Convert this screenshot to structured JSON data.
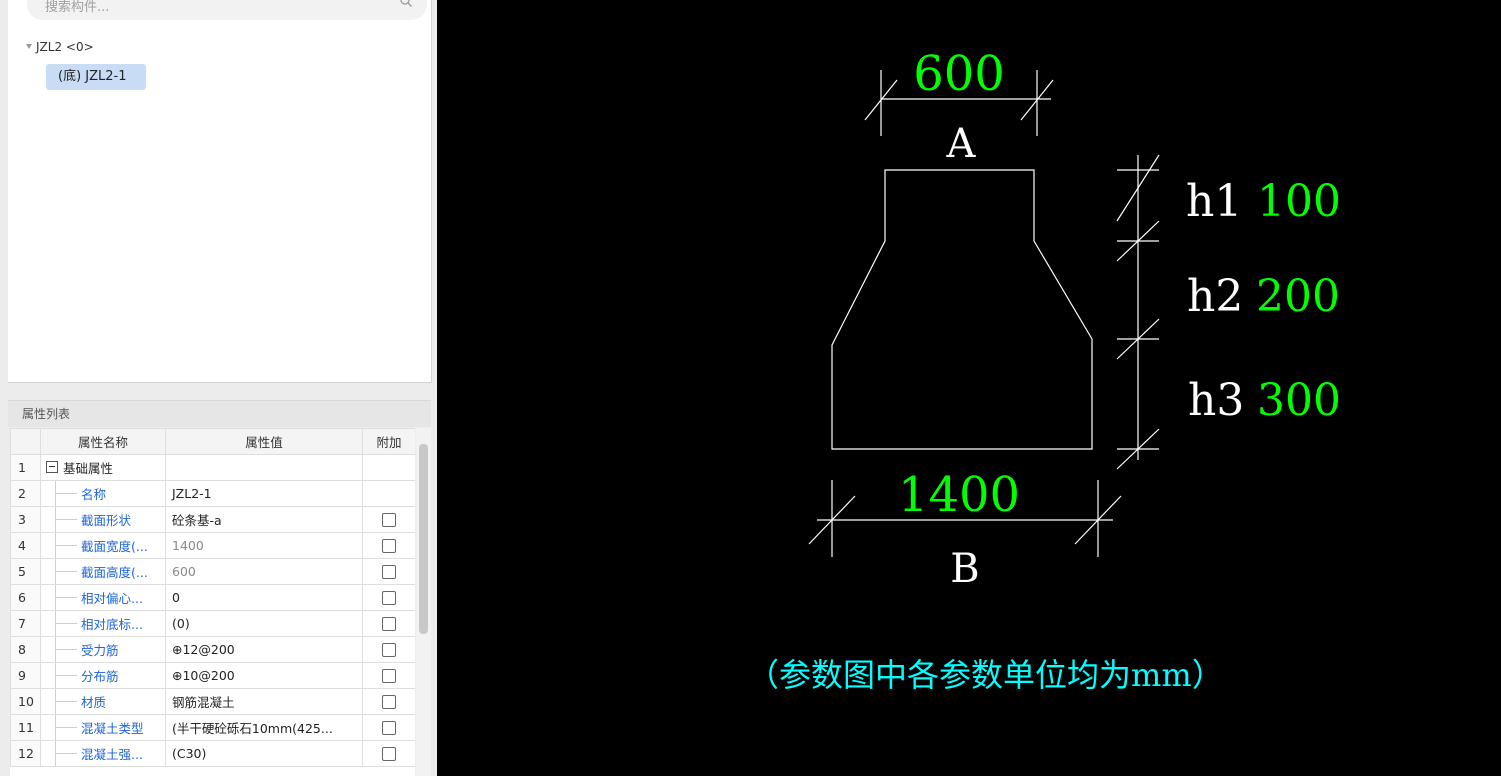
{
  "search": {
    "placeholder": "搜索构件..."
  },
  "tree": {
    "root": "JZL2 <0>",
    "child": "(底) JZL2-1"
  },
  "properties": {
    "panel_title": "属性列表",
    "columns": [
      "属性名称",
      "属性值",
      "附加"
    ],
    "rows": [
      {
        "no": "1",
        "name": "基础属性",
        "value": "",
        "group": true
      },
      {
        "no": "2",
        "name": "名称",
        "value": "JZL2-1",
        "checkbox": false
      },
      {
        "no": "3",
        "name": "截面形状",
        "value": "砼条基-a",
        "checkbox": true
      },
      {
        "no": "4",
        "name": "截面宽度(...",
        "value": "1400",
        "checkbox": true,
        "grey": true
      },
      {
        "no": "5",
        "name": "截面高度(...",
        "value": "600",
        "checkbox": true,
        "grey": true
      },
      {
        "no": "6",
        "name": "相对偏心...",
        "value": "0",
        "checkbox": true
      },
      {
        "no": "7",
        "name": "相对底标...",
        "value": "(0)",
        "checkbox": true
      },
      {
        "no": "8",
        "name": "受力筋",
        "value": "⊕12@200",
        "checkbox": true
      },
      {
        "no": "9",
        "name": "分布筋",
        "value": "⊕10@200",
        "checkbox": true
      },
      {
        "no": "10",
        "name": "材质",
        "value": "钢筋混凝土",
        "checkbox": true
      },
      {
        "no": "11",
        "name": "混凝土类型",
        "value": "(半干硬砼砾石10mm(425...",
        "checkbox": true
      },
      {
        "no": "12",
        "name": "混凝土强...",
        "value": "(C30)",
        "checkbox": true
      }
    ]
  },
  "drawing": {
    "top_width": "600",
    "top_label": "A",
    "bottom_width": "1400",
    "bottom_label": "B",
    "h1_label": "h1",
    "h1_value": "100",
    "h2_label": "h2",
    "h2_value": "200",
    "h3_label": "h3",
    "h3_value": "300",
    "note": "（参数图中各参数单位均为mm）",
    "colors": {
      "background": "#000000",
      "lines": "#ffffff",
      "values": "#00ff00",
      "note": "#00ffff"
    }
  }
}
